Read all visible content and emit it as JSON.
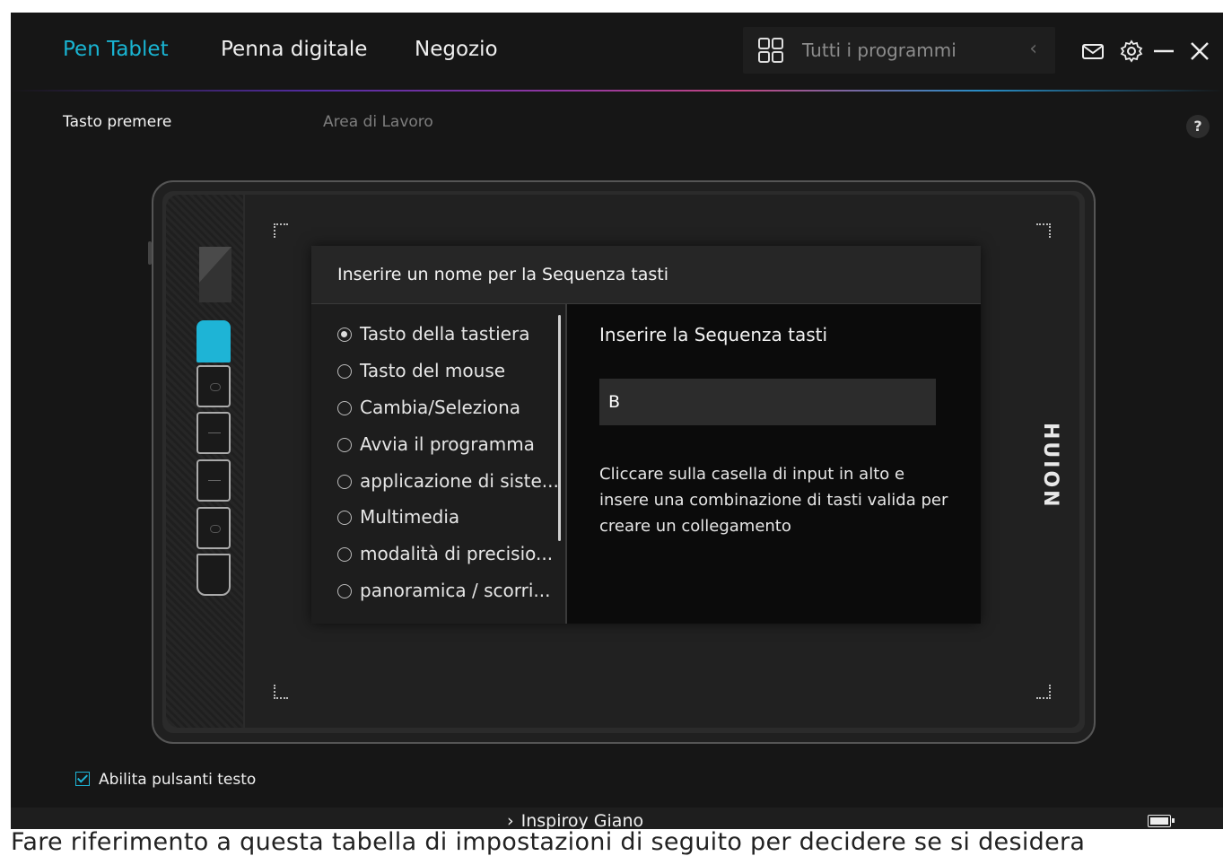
{
  "nav": {
    "tabs": [
      {
        "label": "Pen Tablet",
        "active": true
      },
      {
        "label": "Penna digitale",
        "active": false
      },
      {
        "label": "Negozio",
        "active": false
      }
    ],
    "programs_label": "Tutti i programmi"
  },
  "subtabs": {
    "keypress": "Tasto premere",
    "workarea": "Area di Lavoro",
    "help": "?"
  },
  "dialog": {
    "title": "Inserire un nome per la Sequenza tasti",
    "options": [
      {
        "label": "Tasto della tastiera",
        "selected": true
      },
      {
        "label": "Tasto del mouse",
        "selected": false
      },
      {
        "label": "Cambia/Seleziona",
        "selected": false
      },
      {
        "label": "Avvia il programma",
        "selected": false
      },
      {
        "label": "applicazione di siste...",
        "selected": false
      },
      {
        "label": "Multimedia",
        "selected": false
      },
      {
        "label": "modalità di precisio...",
        "selected": false
      },
      {
        "label": "panoramica / scorri...",
        "selected": false
      }
    ],
    "right_title": "Inserire la Sequenza tasti",
    "key_value": "B",
    "help_text": "Cliccare sulla casella di input in alto e insere una combinazione di tasti valida per creare un collegamento"
  },
  "tablet": {
    "brand": "HUION"
  },
  "footer": {
    "enable_text_buttons": "Abilita pulsanti testo",
    "device": "Inspiroy Giano"
  },
  "page_caption": "Fare riferimento a questa tabella di impostazioni di seguito per decidere se si desidera",
  "colors": {
    "accent": "#19b4d2",
    "background": "#161616"
  }
}
